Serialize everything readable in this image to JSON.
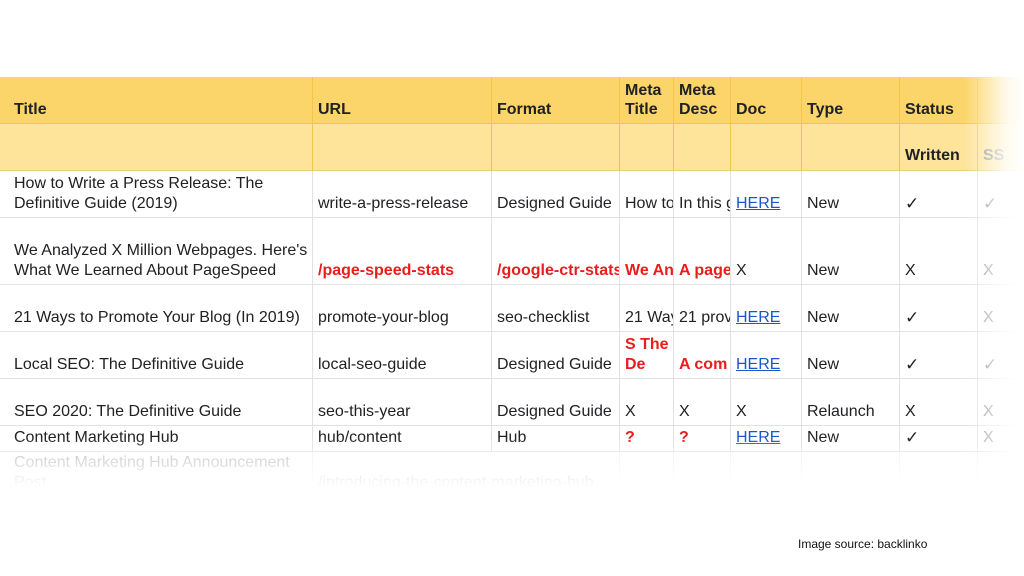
{
  "headers": [
    "Title",
    "URL",
    "Format",
    "Meta Title",
    "Meta Desc",
    "Doc",
    "Type",
    "Status"
  ],
  "subheaders": {
    "status_written": "Written",
    "status_ss": "SS"
  },
  "rows": [
    {
      "title": "How to Write a Press Release: The Definitive Guide (2019)",
      "url": "write-a-press-release",
      "format": "Designed Guide",
      "meta_title": "How to",
      "meta_desc": "In this g",
      "doc": "HERE",
      "type": "New",
      "written": "✓",
      "ss": "✓"
    },
    {
      "title": "We Analyzed X Million Webpages. Here's What We Learned About PageSpeed",
      "url": "/page-speed-stats",
      "format": "/google-ctr-stats",
      "meta_title": "We An",
      "meta_desc": "A page",
      "doc": "X",
      "type": "New",
      "written": "X",
      "ss": "X"
    },
    {
      "title": "21 Ways to Promote Your Blog (In 2019)",
      "url": "promote-your-blog",
      "format": "seo-checklist",
      "meta_title": "21 Way",
      "meta_desc": "21 prov",
      "doc": "HERE",
      "type": "New",
      "written": "✓",
      "ss": "X"
    },
    {
      "title": "Local SEO: The Definitive Guide",
      "url": "local-seo-guide",
      "format": "Designed Guide",
      "meta_title": "Local S The De",
      "meta_desc": "A com",
      "doc": "HERE",
      "type": "New",
      "written": "✓",
      "ss": "✓"
    },
    {
      "title": "SEO 2020: The Definitive Guide",
      "url": "seo-this-year",
      "format": "Designed Guide",
      "meta_title": "X",
      "meta_desc": "X",
      "doc": "X",
      "type": "Relaunch",
      "written": "X",
      "ss": "X"
    },
    {
      "title": "Content Marketing Hub",
      "url": "hub/content",
      "format": "Hub",
      "meta_title": "?",
      "meta_desc": "?",
      "doc": "HERE",
      "type": "New",
      "written": "✓",
      "ss": "X"
    },
    {
      "title": "Content Marketing Hub Announcement Post",
      "url": "/introducing-the-content-marketing-hub",
      "format": "",
      "meta_title": "",
      "meta_desc": "",
      "doc": "",
      "type": "",
      "written": "",
      "ss": ""
    }
  ],
  "caption": "Image source: backlinko",
  "colors": {
    "header": "#fbd569",
    "subheader": "#fde49a",
    "red_text": "#ea1c1c",
    "link": "#1a55cc"
  }
}
